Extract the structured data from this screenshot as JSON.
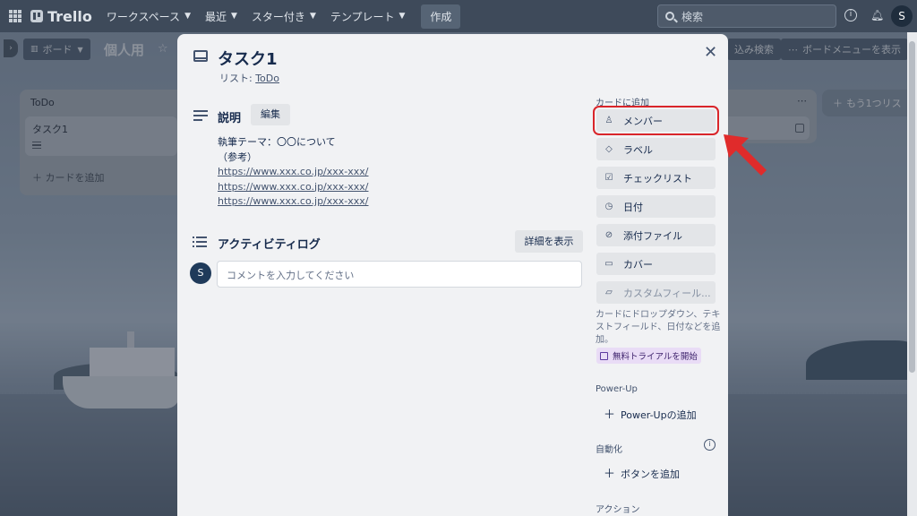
{
  "topbar": {
    "logo": "Trello",
    "nav": [
      {
        "label": "ワークスペース"
      },
      {
        "label": "最近"
      },
      {
        "label": "スター付き"
      },
      {
        "label": "テンプレート"
      }
    ],
    "create_label": "作成",
    "search_placeholder": "検索",
    "avatar": "S"
  },
  "board": {
    "view_label": "ボード",
    "name": "個人用",
    "filter_label": "込み検索",
    "menu_label": "ボードメニューを表示",
    "add_list_label": "もう1つリス"
  },
  "list_todo": {
    "title": "ToDo",
    "card_title": "タスク1",
    "add_card": "カードを追加"
  },
  "modal": {
    "title": "タスク1",
    "in_list_prefix": "リスト: ",
    "in_list_name": "ToDo",
    "description_title": "説明",
    "edit_label": "編集",
    "description_lines": [
      "執筆テーマ：〇〇について",
      "（参考）"
    ],
    "links": [
      "https://www.xxx.co.jp/xxx-xxx/",
      "https://www.xxx.co.jp/xxx-xxx/",
      "https://www.xxx.co.jp/xxx-xxx/"
    ],
    "activity_title": "アクティビティログ",
    "show_details": "詳細を表示",
    "comment_avatar": "S",
    "comment_placeholder": "コメントを入力してください"
  },
  "sidebar": {
    "add_to_card": "カードに追加",
    "buttons": [
      {
        "label": "メンバー",
        "icon": "person-icon"
      },
      {
        "label": "ラベル",
        "icon": "tag-icon"
      },
      {
        "label": "チェックリスト",
        "icon": "checkbox-icon"
      },
      {
        "label": "日付",
        "icon": "clock-icon"
      },
      {
        "label": "添付ファイル",
        "icon": "paperclip-icon"
      },
      {
        "label": "カバー",
        "icon": "cover-icon"
      },
      {
        "label": "カスタムフィール...",
        "icon": "folder-icon"
      }
    ],
    "trial_note": "カードにドロップダウン、テキストフィールド、日付などを追加。",
    "trial_button": "無料トライアルを開始",
    "powerup_label": "Power-Up",
    "powerup_add": "Power-Upの追加",
    "automation_label": "自動化",
    "add_button": "ボタンを追加",
    "actions_label": "アクション"
  },
  "colors": {
    "highlight": "#d9252a",
    "topbar": "#3e4a5a",
    "modal_bg": "#f1f2f4"
  }
}
